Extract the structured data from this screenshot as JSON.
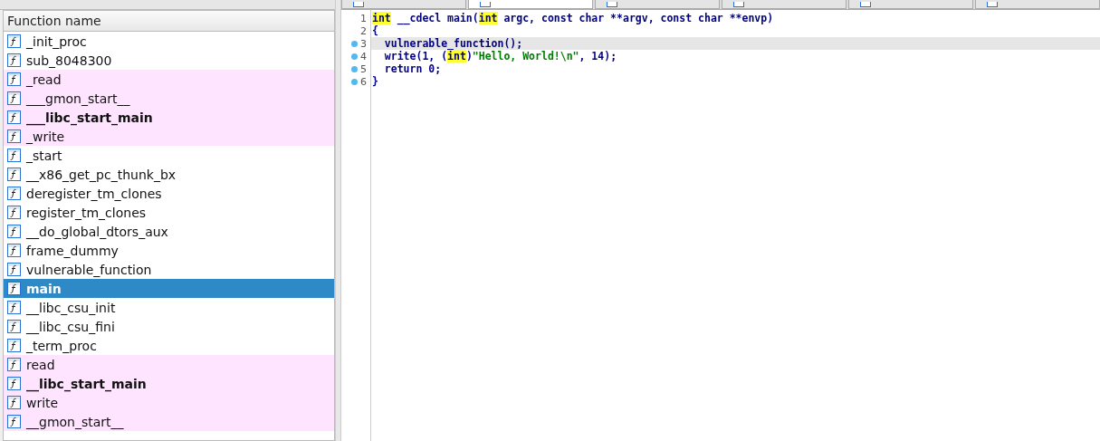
{
  "functions": {
    "column_header": "Function name",
    "rows": [
      {
        "name": "_init_proc",
        "bold": false,
        "imported": false,
        "selected": false
      },
      {
        "name": "sub_8048300",
        "bold": false,
        "imported": false,
        "selected": false
      },
      {
        "name": "_read",
        "bold": false,
        "imported": true,
        "selected": false
      },
      {
        "name": "___gmon_start__",
        "bold": false,
        "imported": true,
        "selected": false
      },
      {
        "name": "___libc_start_main",
        "bold": true,
        "imported": true,
        "selected": false
      },
      {
        "name": "_write",
        "bold": false,
        "imported": true,
        "selected": false
      },
      {
        "name": "_start",
        "bold": false,
        "imported": false,
        "selected": false
      },
      {
        "name": "__x86_get_pc_thunk_bx",
        "bold": false,
        "imported": false,
        "selected": false
      },
      {
        "name": "deregister_tm_clones",
        "bold": false,
        "imported": false,
        "selected": false
      },
      {
        "name": "register_tm_clones",
        "bold": false,
        "imported": false,
        "selected": false
      },
      {
        "name": "__do_global_dtors_aux",
        "bold": false,
        "imported": false,
        "selected": false
      },
      {
        "name": "frame_dummy",
        "bold": false,
        "imported": false,
        "selected": false
      },
      {
        "name": "vulnerable_function",
        "bold": false,
        "imported": false,
        "selected": false
      },
      {
        "name": "main",
        "bold": true,
        "imported": false,
        "selected": true
      },
      {
        "name": "__libc_csu_init",
        "bold": false,
        "imported": false,
        "selected": false
      },
      {
        "name": "__libc_csu_fini",
        "bold": false,
        "imported": false,
        "selected": false
      },
      {
        "name": "_term_proc",
        "bold": false,
        "imported": false,
        "selected": false
      },
      {
        "name": "read",
        "bold": false,
        "imported": true,
        "selected": false
      },
      {
        "name": "__libc_start_main",
        "bold": true,
        "imported": true,
        "selected": false
      },
      {
        "name": "write",
        "bold": false,
        "imported": true,
        "selected": false
      },
      {
        "name": "__gmon_start__",
        "bold": false,
        "imported": true,
        "selected": false
      }
    ]
  },
  "tabs": [
    {
      "selected": false
    },
    {
      "selected": true
    },
    {
      "selected": false
    },
    {
      "selected": false
    },
    {
      "selected": false
    },
    {
      "selected": false
    }
  ],
  "code": {
    "lines": [
      {
        "number": "1",
        "breakpoint": false,
        "current": false,
        "segments": [
          {
            "kind": "hl",
            "text": "int"
          },
          {
            "kind": "plain",
            "text": " __cdecl main("
          },
          {
            "kind": "hl",
            "text": "int"
          },
          {
            "kind": "plain",
            "text": " argc, const char **argv, const char **envp)"
          }
        ]
      },
      {
        "number": "2",
        "breakpoint": false,
        "current": false,
        "segments": [
          {
            "kind": "plain",
            "text": "{"
          }
        ]
      },
      {
        "number": "3",
        "breakpoint": true,
        "current": true,
        "segments": [
          {
            "kind": "plain",
            "text": "  vulnerable_function();"
          }
        ]
      },
      {
        "number": "4",
        "breakpoint": true,
        "current": false,
        "segments": [
          {
            "kind": "plain",
            "text": "  write(1, ("
          },
          {
            "kind": "hl",
            "text": "int"
          },
          {
            "kind": "plain",
            "text": ")"
          },
          {
            "kind": "string",
            "text": "\"Hello, World!\\n\""
          },
          {
            "kind": "plain",
            "text": ", 14);"
          }
        ]
      },
      {
        "number": "5",
        "breakpoint": true,
        "current": false,
        "segments": [
          {
            "kind": "plain",
            "text": "  return 0;"
          }
        ]
      },
      {
        "number": "6",
        "breakpoint": true,
        "current": false,
        "segments": [
          {
            "kind": "plain",
            "text": "}"
          }
        ]
      }
    ]
  }
}
